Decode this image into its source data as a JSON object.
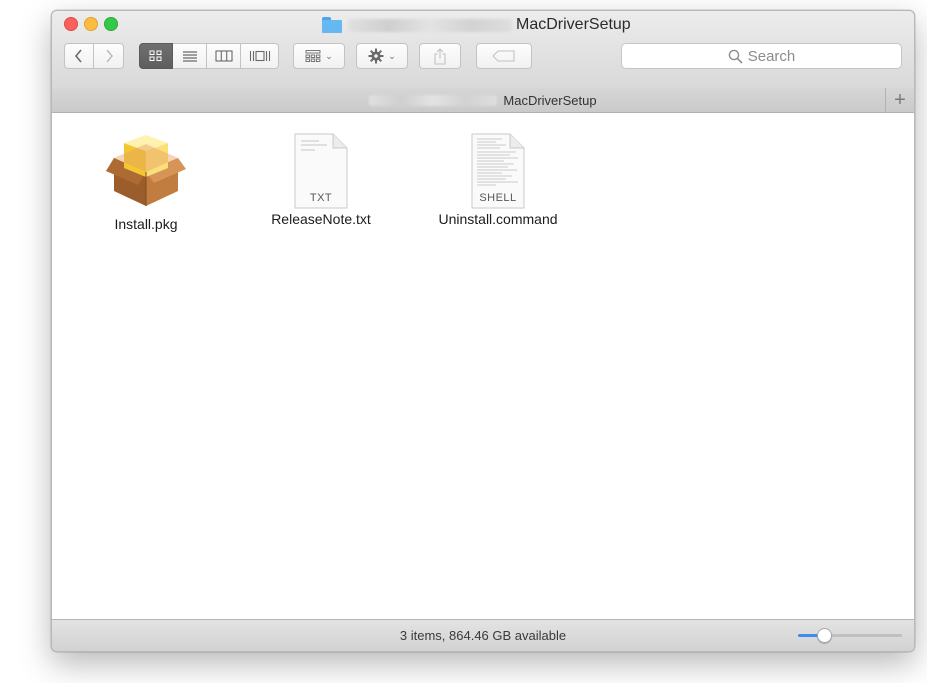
{
  "window": {
    "title": "MacDriverSetup",
    "title_prefix_blurred": "TL-WN823N(EU) 2.0",
    "traffic_lights": {
      "close_color": "#fc605c",
      "minimize_color": "#fdbc40",
      "maximize_color": "#34c84a"
    }
  },
  "toolbar": {
    "back_icon": "chevron-left-icon",
    "forward_icon": "chevron-right-icon",
    "view_modes": [
      {
        "name": "icon-view-icon",
        "active": true
      },
      {
        "name": "list-view-icon",
        "active": false
      },
      {
        "name": "column-view-icon",
        "active": false
      },
      {
        "name": "cover-flow-icon",
        "active": false
      }
    ],
    "group_icon": "group-by-icon",
    "action_icon": "gear-icon",
    "share_icon": "share-icon",
    "tags_icon": "tag-icon",
    "search_placeholder": "Search"
  },
  "pathbar": {
    "current": "MacDriverSetup",
    "prefix_blurred": "TL-WN823N(EU) 2.0",
    "add_tab_label": "+"
  },
  "files": [
    {
      "name": "Install.pkg",
      "icon": "package-icon"
    },
    {
      "name": "ReleaseNote.txt",
      "icon": "text-document-icon",
      "tag": "TXT"
    },
    {
      "name": "Uninstall.command",
      "icon": "shell-script-icon",
      "tag": "SHELL"
    }
  ],
  "status": {
    "text": "3 items, 864.46 GB available",
    "icon_size_level": 0.25,
    "accent": "#3b8ef0"
  }
}
